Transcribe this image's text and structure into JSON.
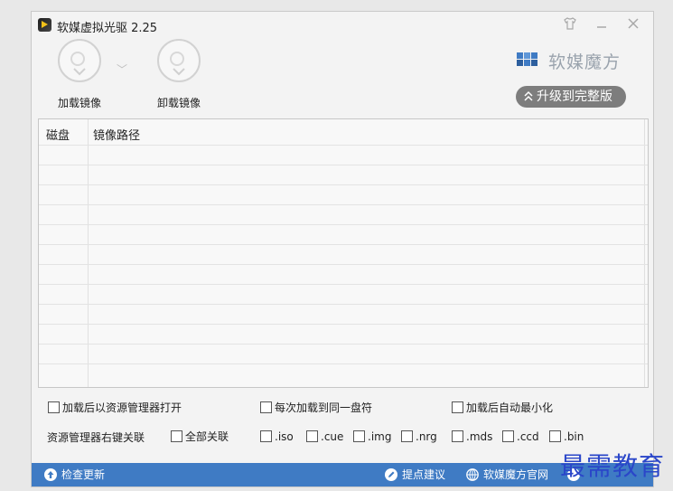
{
  "window": {
    "title": "软媒虚拟光驱 2.25",
    "controls": {
      "skin": "shirt-icon",
      "minimize": "minimize-icon",
      "close": "close-icon"
    }
  },
  "toolbar": {
    "load_label": "加载镜像",
    "unload_label": "卸载镜像"
  },
  "brand": {
    "name": "软媒魔方",
    "upgrade_label": "升级到完整版",
    "upgrade_chevron": "≈"
  },
  "table": {
    "columns": [
      "磁盘",
      "镜像路径"
    ],
    "rows": []
  },
  "options": {
    "open_explorer_after_mount": "加载后以资源管理器打开",
    "same_drive_letter": "每次加载到同一盘符",
    "minimize_after_mount": "加载后自动最小化",
    "assoc_label": "资源管理器右键关联",
    "assoc_all": "全部关联",
    "extensions": [
      ".iso",
      ".cue",
      ".img",
      ".nrg",
      ".mds",
      ".ccd",
      ".bin"
    ]
  },
  "statusbar": {
    "check_update": "检查更新",
    "suggestion": "提点建议",
    "official_site": "软媒魔方官网"
  },
  "watermark": "最需教育",
  "colors": {
    "status_bar": "#3f7bc4",
    "watermark": "#2a46c9"
  }
}
